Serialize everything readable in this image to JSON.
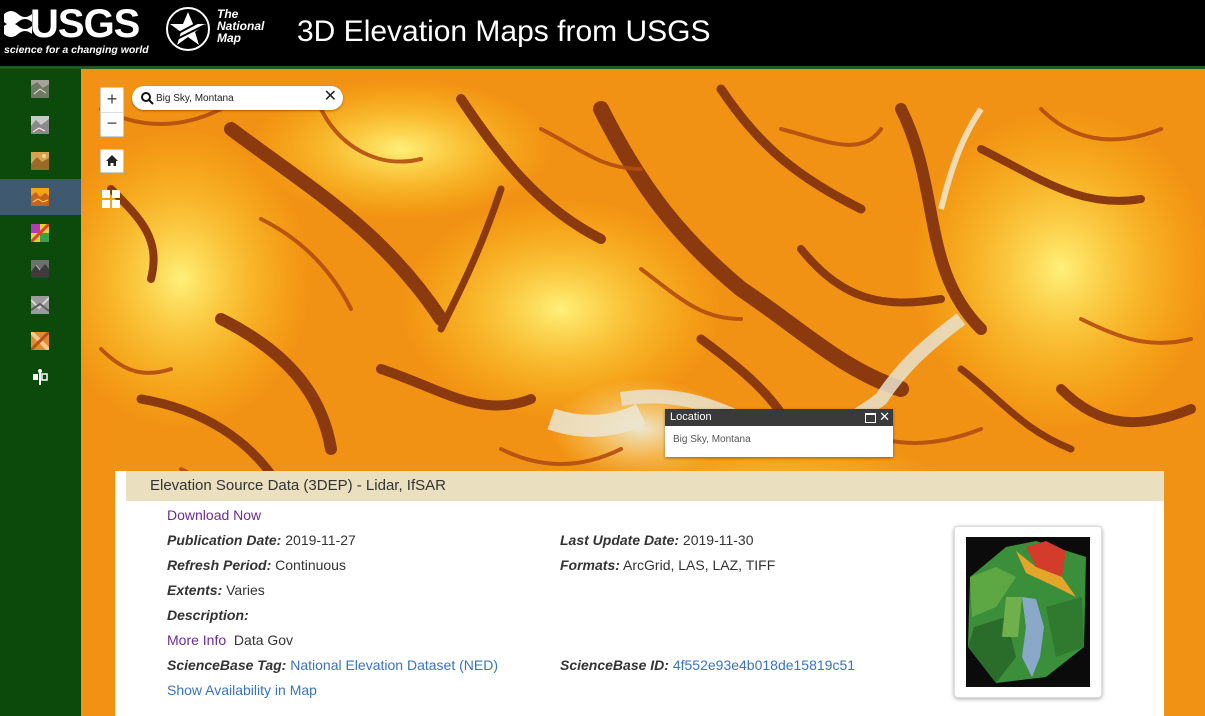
{
  "header": {
    "usgs_word": "USGS",
    "usgs_tagline": "science for a changing world",
    "tnm_lines": [
      "The",
      "National",
      "Map"
    ],
    "title": "3D Elevation Maps from USGS"
  },
  "sidebar": {
    "items": [
      {
        "icon": "imagery-topo-icon",
        "active": false
      },
      {
        "icon": "imagery-gray-icon",
        "active": false
      },
      {
        "icon": "shaded-relief-icon",
        "active": false
      },
      {
        "icon": "elevation-tint-icon",
        "active": true
      },
      {
        "icon": "color-elevation-icon",
        "active": false
      },
      {
        "icon": "hillshade-icon",
        "active": false
      },
      {
        "icon": "slope-icon",
        "active": false
      },
      {
        "icon": "aspect-icon",
        "active": false
      },
      {
        "icon": "compare-swipe-icon",
        "active": false
      }
    ]
  },
  "map": {
    "zoom_in": "+",
    "zoom_out": "−",
    "search": {
      "value": "Big Sky, Montana",
      "clear": "✕"
    },
    "popup": {
      "title": "Location",
      "close": "✕",
      "text": "Big Sky, Montana"
    }
  },
  "panel": {
    "title": "Elevation Source Data (3DEP) - Lidar, IfSAR",
    "download": "Download Now",
    "publication_date_label": "Publication Date:",
    "publication_date": "2019-11-27",
    "last_update_label": "Last Update Date:",
    "last_update": "2019-11-30",
    "refresh_label": "Refresh Period:",
    "refresh": "Continuous",
    "formats_label": "Formats:",
    "formats": "ArcGrid, LAS, LAZ, TIFF",
    "extents_label": "Extents:",
    "extents": "Varies",
    "description_label": "Description:",
    "more_info": "More Info",
    "data_gov": "Data Gov",
    "sb_tag_label": "ScienceBase Tag:",
    "sb_tag": "National Elevation Dataset (NED)",
    "sb_id_label": "ScienceBase ID:",
    "sb_id": "4f552e93e4b018de15819c51",
    "show_availability": "Show Availability in Map"
  },
  "colors": {
    "header_bg": "#000000",
    "sidebar_bg": "#0b4a0b",
    "sidebar_active": "#3f5970",
    "panel_head": "#eadfbf",
    "link_purple": "#6b2d91",
    "link_blue": "#3b73b9"
  }
}
